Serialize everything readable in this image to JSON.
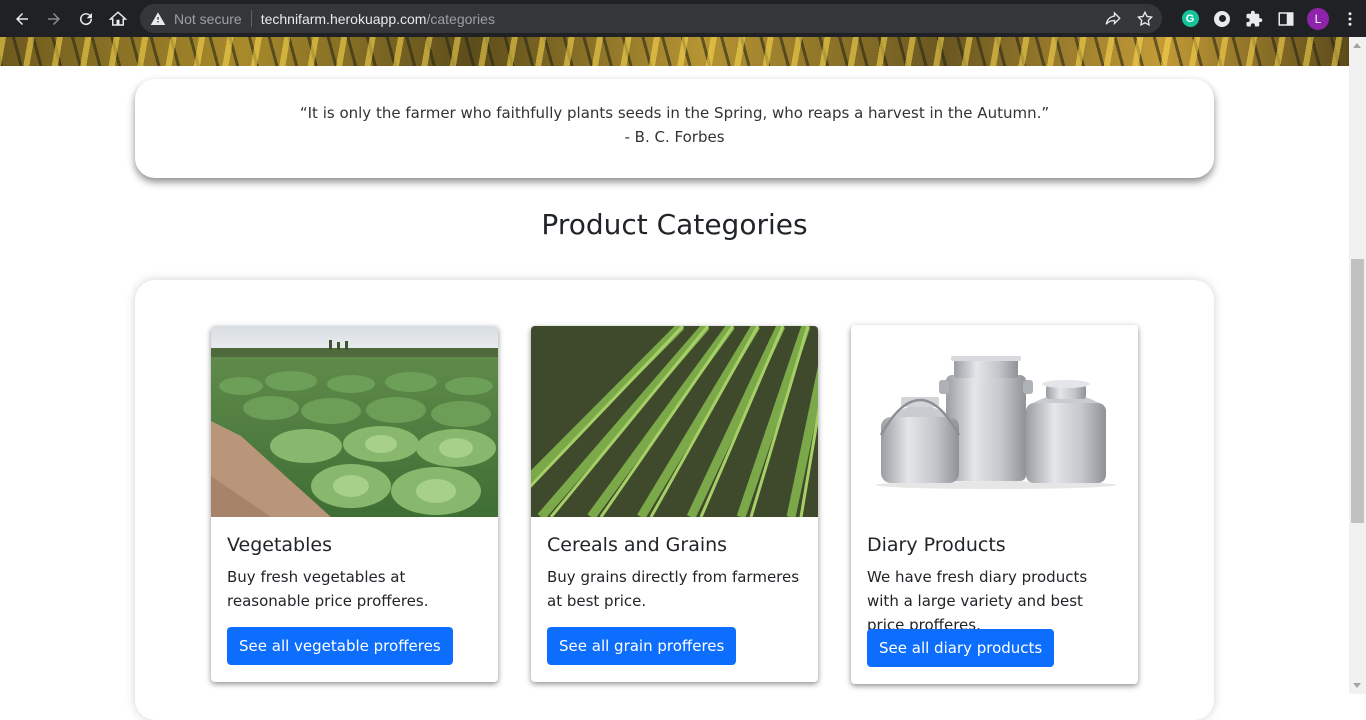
{
  "browser": {
    "security_label": "Not secure",
    "url_host": "technifarm.herokuapp.com",
    "url_path": "/categories",
    "profile_initial": "L",
    "extension_initial": "G"
  },
  "quote": {
    "text": "“It is only the farmer who faithfully plants seeds in the Spring, who reaps a harvest in the Autumn.”",
    "author": "- B. C. Forbes"
  },
  "section": {
    "title": "Product Categories"
  },
  "categories": [
    {
      "title": "Vegetables",
      "description": "Buy fresh vegetables at reasonable price profferes.",
      "button": "See all vegetable profferes"
    },
    {
      "title": "Cereals and Grains",
      "description": "Buy grains directly from farmeres at best price.",
      "button": "See all grain profferes"
    },
    {
      "title": "Diary Products",
      "description": "We have fresh diary products with a large variety and best price profferes.",
      "button": "See all diary products"
    }
  ],
  "colors": {
    "primary_button": "#0d6efd",
    "chrome_bg": "#202124"
  }
}
